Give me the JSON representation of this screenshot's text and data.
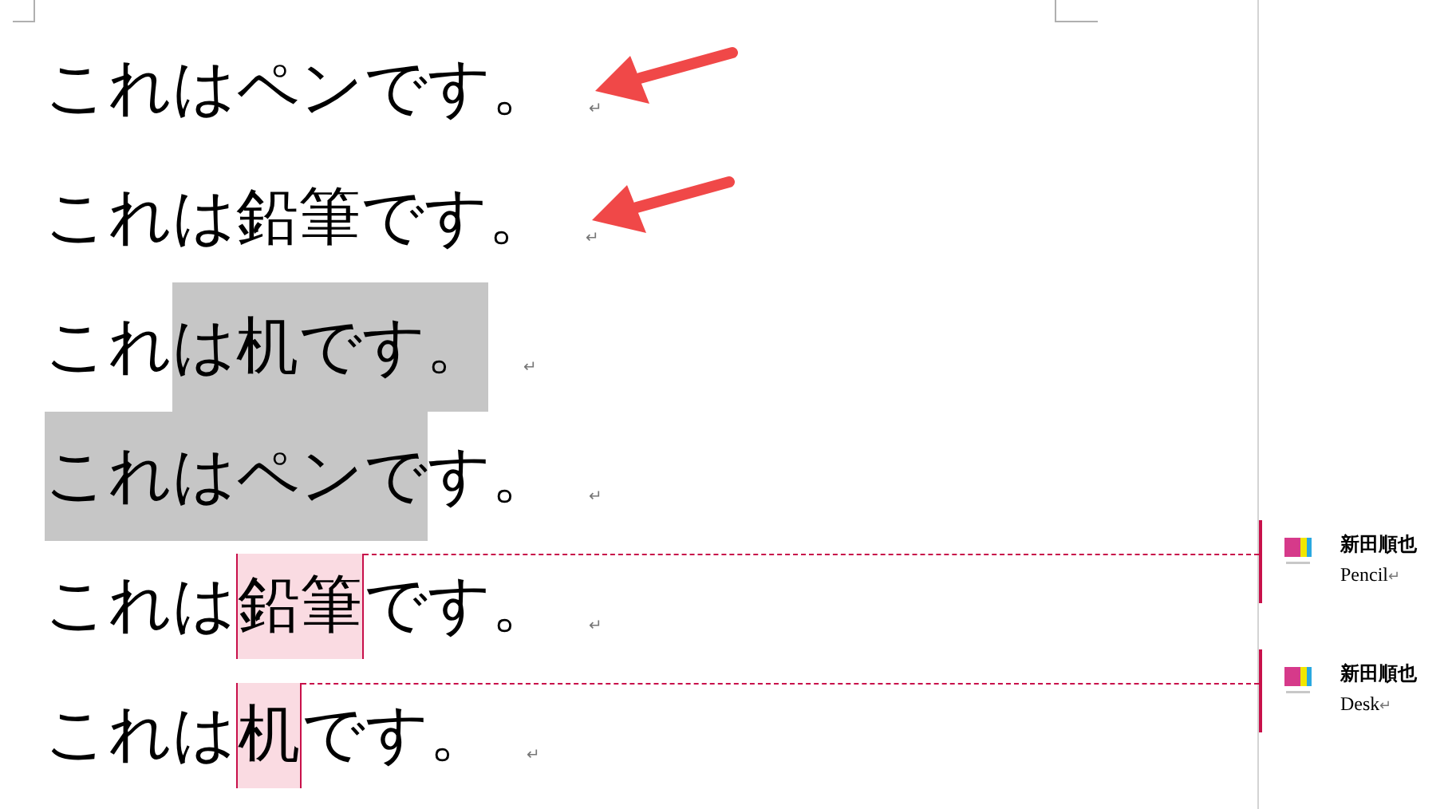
{
  "document": {
    "paragraphs": [
      {
        "segments": [
          {
            "text": "これはペンです。",
            "selected": false,
            "commented": false
          }
        ],
        "end_mark": "↵",
        "arrow": true
      },
      {
        "segments": [
          {
            "text": "これは鉛筆です。",
            "selected": false,
            "commented": false
          }
        ],
        "end_mark": "↵",
        "arrow": true
      },
      {
        "segments": [
          {
            "text": "これ",
            "selected": false,
            "commented": false
          },
          {
            "text": "は机です。",
            "selected": true,
            "commented": false
          }
        ],
        "end_mark": "↵",
        "arrow": false
      },
      {
        "segments": [
          {
            "text": "これはペンで",
            "selected": true,
            "commented": false
          },
          {
            "text": "す。",
            "selected": false,
            "commented": false
          }
        ],
        "end_mark": "↵",
        "arrow": false
      },
      {
        "segments": [
          {
            "text": "これは",
            "selected": false,
            "commented": false
          },
          {
            "text": "鉛筆",
            "selected": false,
            "commented": true
          },
          {
            "text": "です。",
            "selected": false,
            "commented": false
          }
        ],
        "end_mark": "↵",
        "arrow": false
      },
      {
        "segments": [
          {
            "text": "これは",
            "selected": false,
            "commented": false
          },
          {
            "text": "机",
            "selected": false,
            "commented": true
          },
          {
            "text": "です。",
            "selected": false,
            "commented": false
          }
        ],
        "end_mark": "↵",
        "arrow": false
      }
    ]
  },
  "comments": [
    {
      "author": "新田順也",
      "text": "Pencil",
      "end_mark": "↵"
    },
    {
      "author": "新田順也",
      "text": "Desk",
      "end_mark": "↵"
    }
  ]
}
